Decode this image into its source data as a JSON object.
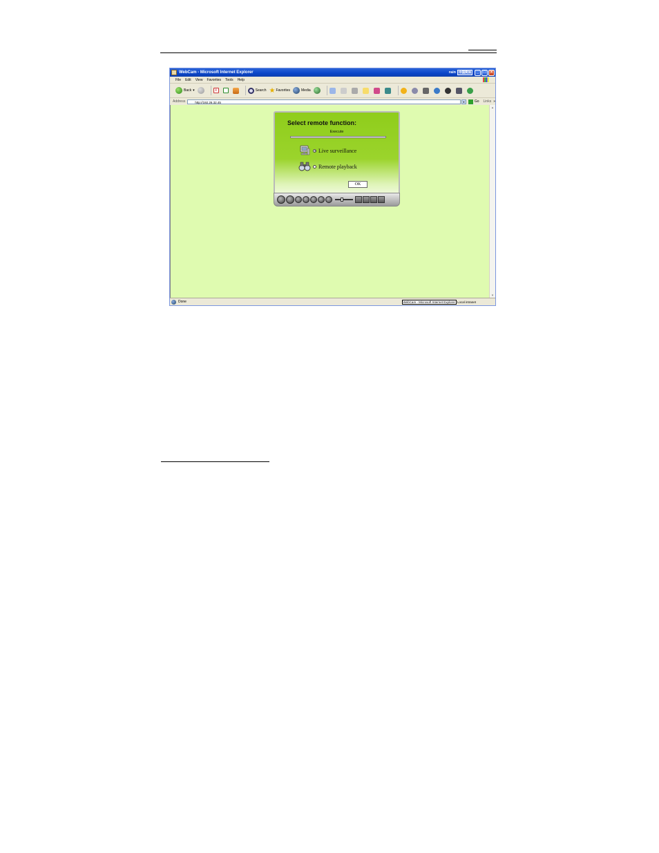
{
  "window": {
    "title": "WebCam - Microsoft Internet Explorer",
    "user": "rain",
    "lang_badge": "中国简体"
  },
  "menu": [
    "File",
    "Edit",
    "View",
    "Favorites",
    "Tools",
    "Help"
  ],
  "toolbar": {
    "back_label": "Back",
    "search_label": "Search",
    "favorites_label": "Favorites",
    "media_label": "Media"
  },
  "address": {
    "label": "Address",
    "url": "http://192.26.32.45",
    "go_label": "Go",
    "links_label": "Links"
  },
  "panel": {
    "title": "Select remote function:",
    "status": "Execute",
    "options": [
      {
        "label": "Live surveillance",
        "selected": true,
        "icon": "monitor-icon"
      },
      {
        "label": "Remote playback",
        "selected": false,
        "icon": "binoculars-icon"
      }
    ],
    "ok_label": "OK"
  },
  "statusbar": {
    "text": "Done",
    "task": "WebCam - Microsoft Internet Explorer",
    "zone": "Local intranet"
  },
  "colors": {
    "page_bg": "#dffbb0",
    "panel_green": "#8fcd1b",
    "title_blue": "#0a45c8"
  }
}
